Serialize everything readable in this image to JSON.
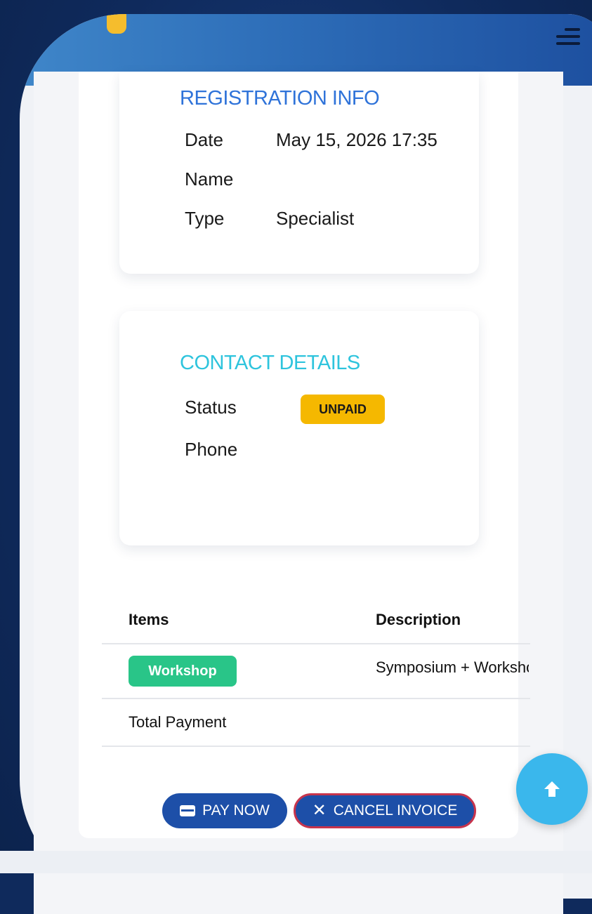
{
  "colors": {
    "header_gradient": [
      "#3f86c9",
      "#1d4f9f"
    ],
    "accent_blue": "#2f73d9",
    "accent_cyan": "#2ec4dd",
    "unpaid_badge": "#f5b800",
    "workshop_tag": "#29c588",
    "button_bg": "#1d4fa8",
    "cancel_border": "#c7344c",
    "scroll_top_bg": "#3ab7ec"
  },
  "header": {
    "logo_icon": "logo-mark",
    "menu_icon": "hamburger-menu-icon"
  },
  "registration": {
    "title": "REGISTRATION INFO",
    "rows": [
      {
        "label": "Date",
        "value": "May 15, 2026 17:35"
      },
      {
        "label": "Name",
        "value": ""
      },
      {
        "label": "Type",
        "value": "Specialist"
      }
    ]
  },
  "contact": {
    "title": "CONTACT DETAILS",
    "status_label": "Status",
    "status_value": "UNPAID",
    "phone_label": "Phone",
    "phone_value": ""
  },
  "table": {
    "headers": [
      "Items",
      "Description"
    ],
    "rows": [
      {
        "item": "Workshop",
        "description": "Symposium + Workshop"
      }
    ],
    "total_label": "Total Payment"
  },
  "actions": {
    "pay_label": "PAY NOW",
    "pay_icon": "credit-card-icon",
    "cancel_label": "CANCEL INVOICE",
    "cancel_icon": "close-icon"
  },
  "scroll_top": {
    "icon": "arrow-up-icon"
  }
}
